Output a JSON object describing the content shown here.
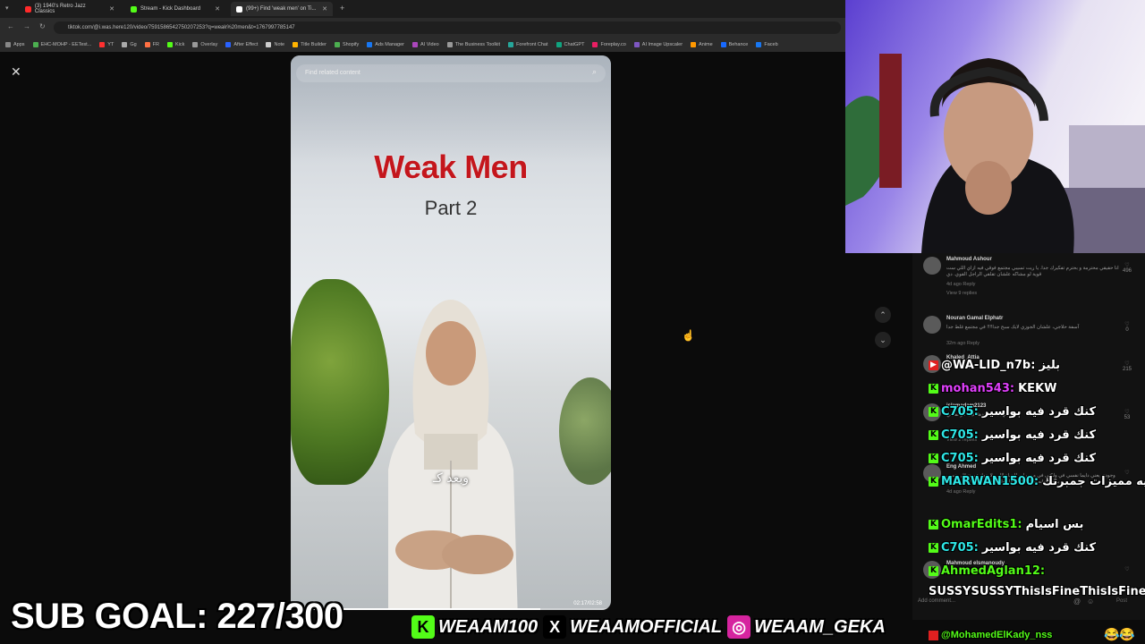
{
  "browser": {
    "tabs": [
      {
        "label": "(3) 1940's Retro Jazz Classics",
        "favicon": "#ff2a2a",
        "active": false
      },
      {
        "label": "Stream - Kick Dashboard",
        "favicon": "#53fc18",
        "active": false
      },
      {
        "label": "(99+) Find 'weak men' on Ti...",
        "favicon": "#ffffff",
        "active": true
      }
    ],
    "new_tab": "+",
    "url": "tiktok.com/@i.was.here120/video/7591586542750207253?q=weak%20men&t=1767997785147",
    "bookmarks": [
      "Apps",
      "EHC-MOHP - EETest...",
      "YT",
      "Gg",
      "FR",
      "Kick",
      "Overlay",
      "After Effect",
      "Note",
      "Title Builder",
      "Shopify",
      "Ads Manager",
      "AI Video",
      "The Business Toolkit",
      "Forefront Chat",
      "ChatGPT",
      "Foreplay.co",
      "AI Image Upscaler",
      "Anime",
      "Behance",
      "Faceb"
    ]
  },
  "video": {
    "search_placeholder": "Find related content",
    "title": "Weak Men",
    "subtitle": "Part 2",
    "arabic_caption": "وبعد كـ",
    "time": "02:17/02:58",
    "progress": 0.78
  },
  "comments": [
    {
      "name": "Mahmoud Ashour",
      "text": "انا حقيقي محترمة و بحترم تفكيرك جدا. يا ريت تسيبي مجتمع فوقي فيه ازاي اللي ست قوية لو مشاكه علشان تقلقي الراجل القوي. دي",
      "meta": "4d ago   Reply",
      "replies": "View 9 replies",
      "likes": "496"
    },
    {
      "name": "Nouran Gamal Elphatr",
      "text": "آسفة حلاجي، علشان الجوزي لايك سبح جدا!!!! في مجتمع غلط جدا",
      "meta": "32m ago   Reply",
      "likes": "0"
    },
    {
      "name": "Khaled_Attia",
      "text": "",
      "meta": "4d ago   Reply",
      "likes": "215"
    },
    {
      "name": "islamadam2123",
      "text": "مجتهد بقت عندها عيب انو نفسي",
      "meta": "4d ago",
      "replies": "View 2 replies",
      "likes": "53"
    },
    {
      "name": "Eng Ahmed",
      "text": "وجودي يعني دايما نفسي في ولكني في مسيرات الحياة اللهم لا جوازهم يتزوّل يحسن برامبه وانه قد ليه كل محل والزواج وكنت سال نفسي ليه",
      "meta": "4d ago   Reply",
      "likes": ""
    },
    {
      "name": "Mahmoud elsmanoudy",
      "text": "",
      "meta": "",
      "likes": ""
    }
  ],
  "add_comment": "Add comment...",
  "post_label": "Post",
  "chat": [
    {
      "badge": "yt",
      "user": "@WA-LID_n7b:",
      "msg": "بليز"
    },
    {
      "badge": "k",
      "user": "mohan543:",
      "msg": "KEKW",
      "user_color": "#e040fb"
    },
    {
      "badge": "k",
      "user": "C705:",
      "msg": "كنك قرد فيه بواسير",
      "user_color": "#2ee6e6"
    },
    {
      "badge": "k",
      "user": "C705:",
      "msg": "كنك قرد فيه بواسير",
      "user_color": "#2ee6e6"
    },
    {
      "badge": "k",
      "user": "C705:",
      "msg": "كنك قرد فيه بواسير",
      "user_color": "#2ee6e6"
    },
    {
      "badge": "k",
      "user": "MARWAN1500:",
      "msg": "ايوا ايه مميزات جمبرتك",
      "user_color": "#2ee6e6"
    },
    {
      "badge": "k",
      "user": "OmarEdits1:",
      "msg": "بس اسيام",
      "user_color": "#53fc18"
    },
    {
      "badge": "k",
      "user": "C705:",
      "msg": "كنك قرد فيه بواسير",
      "user_color": "#2ee6e6"
    },
    {
      "badge": "k",
      "user": "AhmedAglan12:",
      "msg": "",
      "user_color": "#53fc18"
    }
  ],
  "chat_wrap": "SUSSYSUSSYThisIsFineThisIsFineSUSSY",
  "bottom_chat": "@MohamedElKady_nss",
  "sub_goal": "SUB GOAL: 227/300",
  "socials": [
    {
      "icon": "kick-icon",
      "glyph": "K",
      "color": "#53fc18",
      "handle": "WEAAM100"
    },
    {
      "icon": "x-icon",
      "glyph": "X",
      "color": "#000000",
      "handle": "WEAAMOFFICIAL"
    },
    {
      "icon": "instagram-icon",
      "glyph": "◎",
      "color": "#d6249f",
      "handle": "WEAAM_GEKA"
    }
  ],
  "emotes": "😂😂"
}
